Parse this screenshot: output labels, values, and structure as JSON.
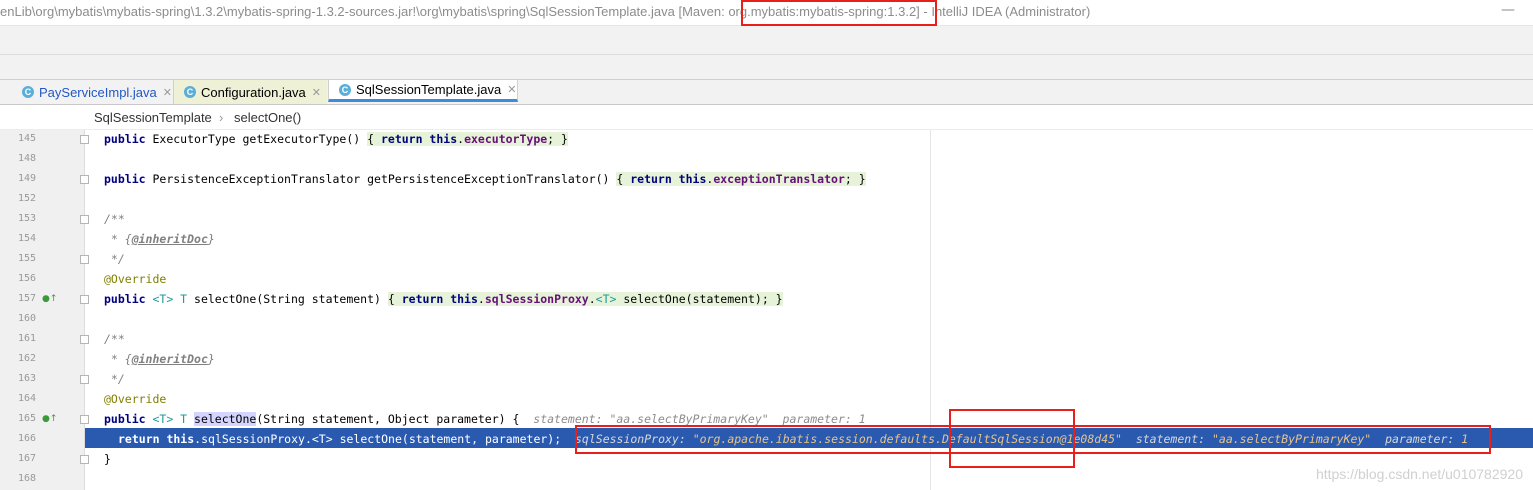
{
  "window": {
    "title": "enLib\\org\\mybatis\\mybatis-spring\\1.3.2\\mybatis-spring-1.3.2-sources.jar!\\org\\mybatis\\spring\\SqlSessionTemplate.java [Maven: org.mybatis:mybatis-spring:1.3.2] - IntelliJ IDEA (Administrator)",
    "minimize_glyph": "—"
  },
  "tabs": [
    {
      "label": "PayServiceImpl.java",
      "icon": "C",
      "close": "✕"
    },
    {
      "label": "Configuration.java",
      "icon": "C",
      "close": "✕"
    },
    {
      "label": "SqlSessionTemplate.java",
      "icon": "C",
      "close": "✕"
    }
  ],
  "breadcrumb": {
    "class_name": "SqlSessionTemplate",
    "separator": "›",
    "method": "selectOne()"
  },
  "code": {
    "line_numbers": [
      "145",
      "148",
      "149",
      "152",
      "153",
      "154",
      "155",
      "156",
      "157",
      "160",
      "161",
      "162",
      "163",
      "164",
      "165",
      "166",
      "167",
      "168"
    ],
    "l145": {
      "kw1": "public",
      "t1": " ExecutorType getExecutorType() ",
      "b1": "{ ",
      "kw2": "return this",
      "dot": ".",
      "fld": "executorType",
      "end": "; }"
    },
    "l149": {
      "kw1": "public",
      "t1": " PersistenceExceptionTranslator getPersistenceExceptionTranslator() ",
      "b1": "{ ",
      "kw2": "return this",
      "dot": ".",
      "fld": "exceptionTranslator",
      "end": "; }"
    },
    "l153": "/**",
    "l154": {
      "pre": " * {",
      "tag": "@inheritDoc",
      "post": "}"
    },
    "l155": " */",
    "l156": "@Override",
    "l157": {
      "kw1": "public",
      "g1": " <T> T",
      "t1": " selectOne(String statement) ",
      "b1": "{ ",
      "kw2": "return this",
      "dot": ".",
      "fld": "sqlSessionProxy",
      "dot2": ".",
      "g2": "<T>",
      "end": " selectOne(statement); }"
    },
    "l161": "/**",
    "l162": {
      "pre": " * {",
      "tag": "@inheritDoc",
      "post": "}"
    },
    "l163": " */",
    "l164": "@Override",
    "l165": {
      "kw1": "public",
      "g1": " <T> T ",
      "sel": "selectOne",
      "t1": "(String statement, Object parameter) {  ",
      "h1": "statement: ",
      "h2": "\"aa.selectByPrimaryKey\"",
      "h3": "  parameter: ",
      "h4": "1"
    },
    "l166": {
      "kw": "return this",
      "t1": ".sqlSessionProxy.",
      "g1": "<T>",
      "t2": " selectOne(statement, parameter);",
      "h1": "sqlSessionProxy: ",
      "h2": "\"org.apache.ibatis.session.defaults.DefaultSqlSession@1e08d45\"",
      "h3": "  statement: ",
      "h4": "\"aa.selectByPrimaryKey\"",
      "h5": "  parameter: ",
      "h6": "1"
    },
    "l167": "}"
  },
  "watermark": "https://blog.csdn.net/u010782920",
  "colors": {
    "highlight_line": "#2a5ab0",
    "annotation_box": "#e8201c",
    "keyword": "#000080",
    "field": "#660e7a"
  }
}
